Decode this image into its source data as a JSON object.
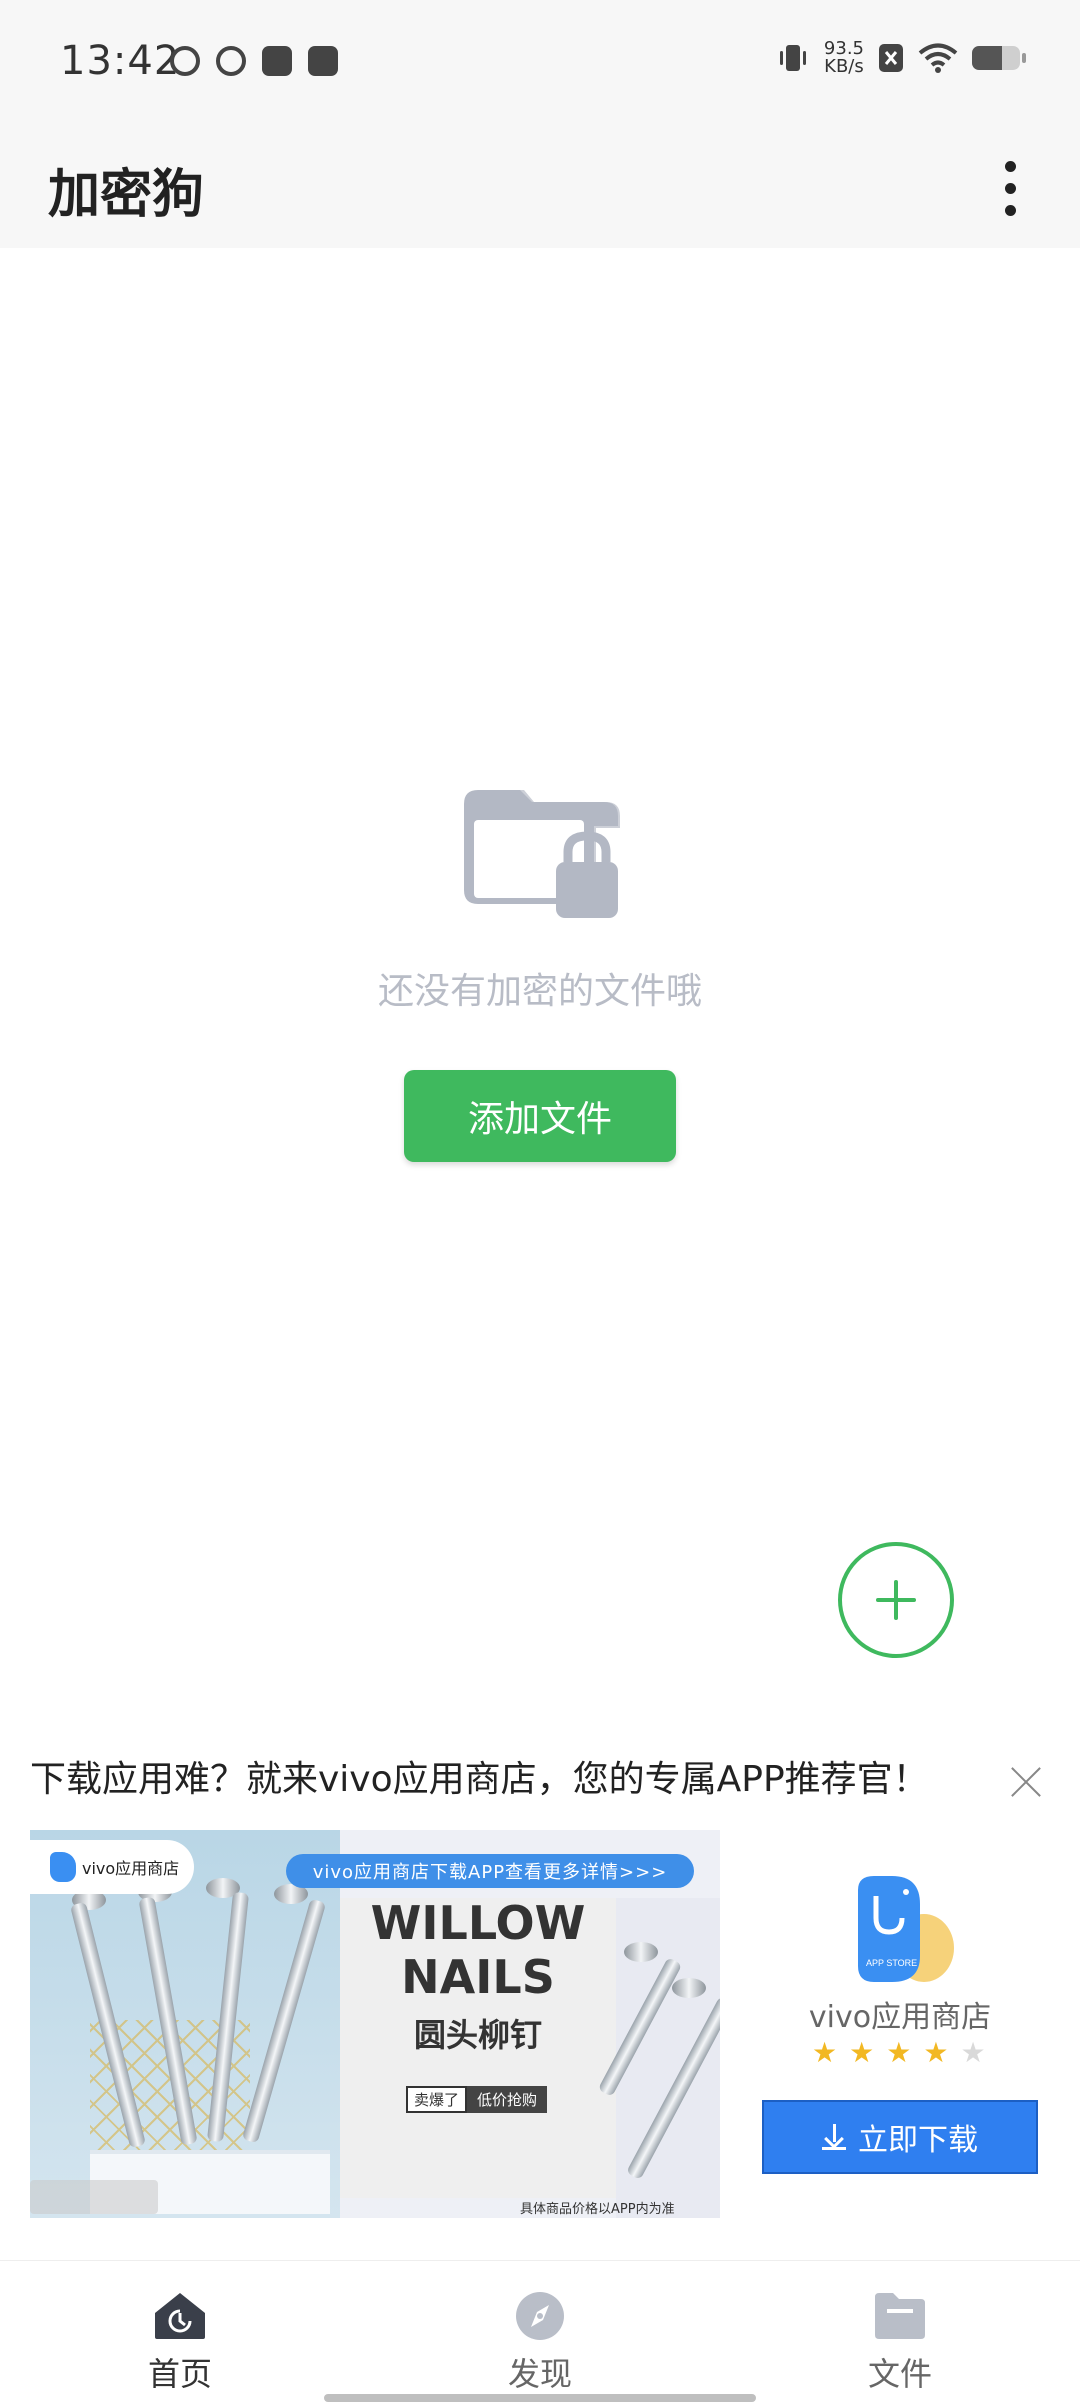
{
  "status_bar": {
    "time": "13:42",
    "net_speed_value": "93.5",
    "net_speed_unit": "KB/s",
    "battery_level": 0.62
  },
  "app_bar": {
    "title": "加密狗",
    "more_icon": "more-vertical-icon"
  },
  "empty_state": {
    "icon": "folder-lock-icon",
    "message": "还没有加密的文件哦",
    "add_button_label": "添加文件"
  },
  "fab": {
    "icon": "plus-icon"
  },
  "ad": {
    "title": "下载应用难？就来vivo应用商店，您的专属APP推荐官！",
    "banner": {
      "logo_text": "vivo应用商店",
      "pill_text": "vivo应用商店下载APP查看更多详情>>>",
      "headline_1": "WILLOW",
      "headline_2": "NAILS",
      "subtitle": "圆头柳钉",
      "tag_1": "卖爆了",
      "tag_2": "低价抢购",
      "disclaimer": "具体商品价格以APP内为准"
    },
    "app_card": {
      "icon_text": "APP STORE",
      "name": "vivo应用商店",
      "rating": 4,
      "rating_max": 5,
      "download_label": "立即下载"
    }
  },
  "bottom_nav": {
    "items": [
      {
        "label": "首页",
        "icon": "home-icon",
        "active": true
      },
      {
        "label": "发现",
        "icon": "compass-icon",
        "active": false
      },
      {
        "label": "文件",
        "icon": "folder-icon",
        "active": false
      }
    ]
  },
  "colors": {
    "accent_green": "#3fb95e",
    "download_blue": "#2f7ff0",
    "star_gold": "#f2b823"
  }
}
